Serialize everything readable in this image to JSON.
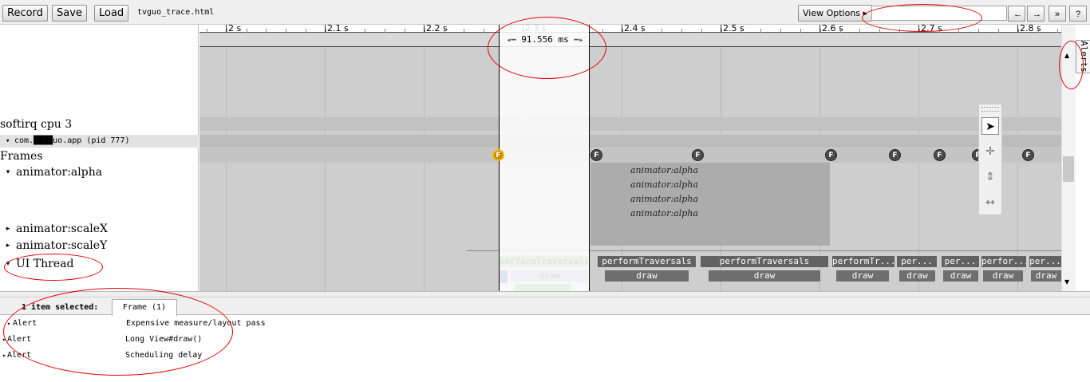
{
  "toolbar": {
    "record_label": "Record",
    "save_label": "Save",
    "load_label": "Load",
    "filename": "tvguo_trace.html",
    "view_options_label": "View Options ▸",
    "search_value": "",
    "prev_label": "←",
    "next_label": "→",
    "collapse_label": "»",
    "help_label": "?"
  },
  "ruler": {
    "major_labels": [
      "2 s",
      "2.1 s",
      "2.2 s",
      "2.3 s",
      "2.4 s",
      "2.5 s",
      "2.6 s",
      "2.7 s",
      "2.8 s"
    ]
  },
  "measurement": {
    "label": "91.556 ms"
  },
  "tracks": {
    "softirq": "softirq cpu 3",
    "process": "com.████uo.app (pid 777)",
    "frames": "Frames",
    "animator_alpha": "animator:alpha",
    "animator_scalex": "animator:scaleX",
    "animator_scaley": "animator:scaleY",
    "ui_thread": "UI Thread"
  },
  "frame_marker_letter": "F",
  "animator_slice_label": "animator:alpha",
  "slices": {
    "perform": "performTraversals",
    "perform_short": "performTr...",
    "per_short": "per...",
    "perfor_short": "perfor...",
    "draw": "draw"
  },
  "side": {
    "alerts_tab": "Alerts"
  },
  "bottom": {
    "selection_count": "1 item selected:",
    "tab_label": "Frame (1)",
    "alerts": [
      {
        "type": "Alert",
        "description": "Expensive measure/layout pass"
      },
      {
        "type": "Alert",
        "description": "Long View#draw()"
      },
      {
        "type": "Alert",
        "description": "Scheduling delay"
      }
    ]
  },
  "colors": {
    "selected_frame": "#cf8a10",
    "perform_slice": "#5e8a4e",
    "draw_slice": "#7f6f9e",
    "annotation": "#e30000"
  }
}
